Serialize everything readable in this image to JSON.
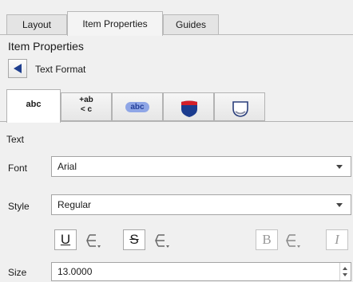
{
  "dock_tabs": [
    "Layout",
    "Item Properties",
    "Guides"
  ],
  "panel_title": "Item Properties",
  "back": {
    "label": "Text Format"
  },
  "format_tabs": [
    {
      "name": "text",
      "glyph": "abc"
    },
    {
      "name": "formatting",
      "glyph_top": "+ab",
      "glyph_bottom": "< c"
    },
    {
      "name": "buffer",
      "glyph": "abc"
    },
    {
      "name": "background",
      "glyph": ""
    },
    {
      "name": "shadow",
      "glyph": ""
    }
  ],
  "section_title": "Text",
  "font": {
    "label": "Font",
    "value": "Arial"
  },
  "style": {
    "label": "Style",
    "value": "Regular"
  },
  "text_buttons": {
    "underline": "U",
    "strikeout": "S",
    "bold": "B",
    "italic": "I"
  },
  "size": {
    "label": "Size",
    "value": "13.0000"
  },
  "colors": {
    "buffer_blue": "#8fa6e6",
    "shield_blue": "#1b3c8f",
    "shield_red": "#d4202a"
  }
}
